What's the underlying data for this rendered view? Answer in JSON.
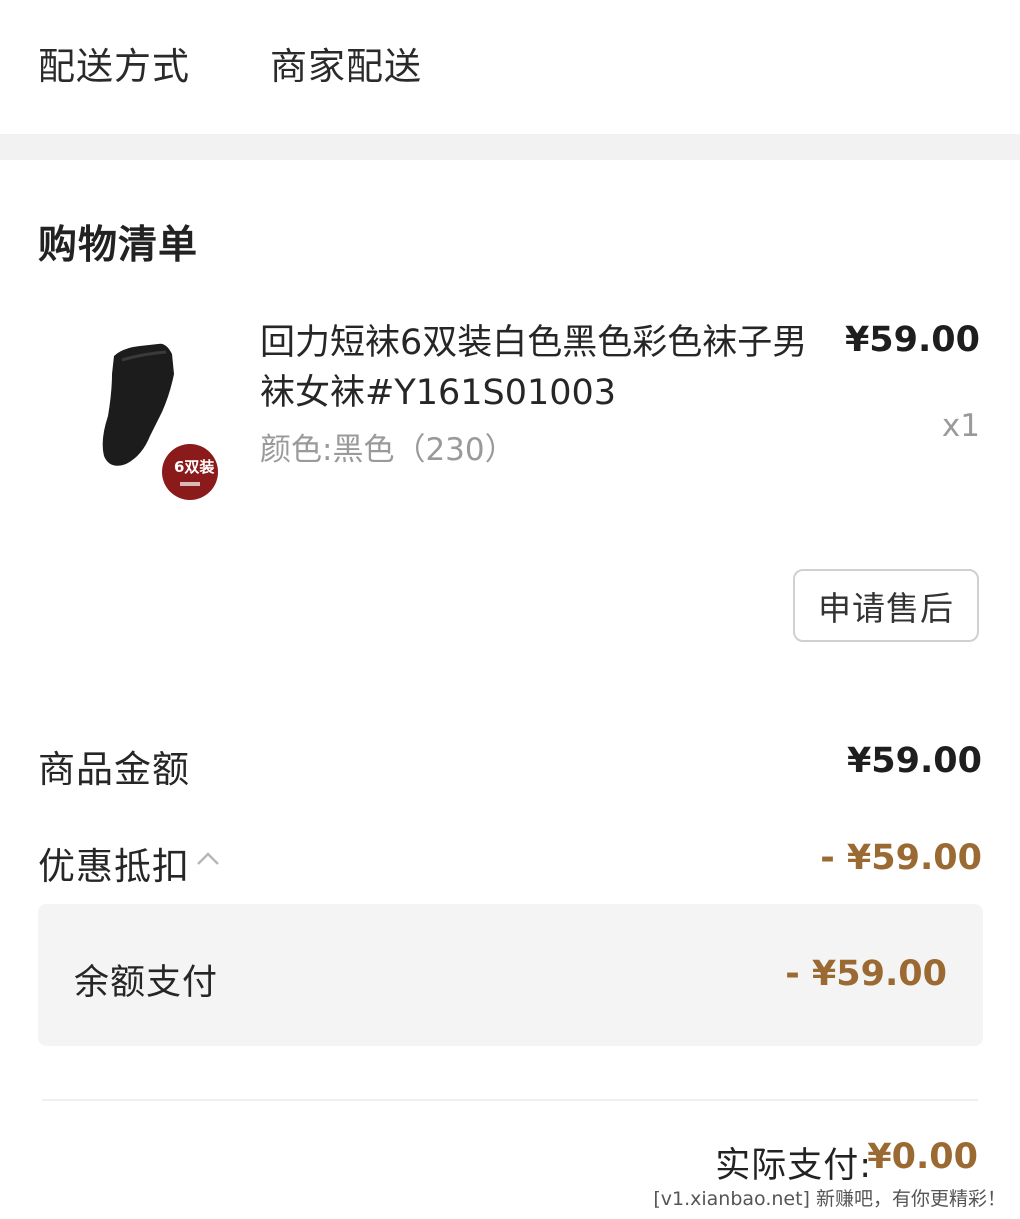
{
  "delivery": {
    "label": "配送方式",
    "value": "商家配送"
  },
  "order": {
    "section_title": "购物清单",
    "product": {
      "name": "回力短袜6双装白色黑色彩色袜子男袜女袜#Y161S01003",
      "spec": "颜色:黑色（230）",
      "price": "¥59.00",
      "quantity": "x1",
      "thumbnail_badge": "6双装",
      "thumbnail_icon": "sock-icon"
    },
    "aftersale_button": "申请售后"
  },
  "summary": {
    "goods_amount_label": "商品金额",
    "goods_amount_value": "¥59.00",
    "discount_label": "优惠抵扣",
    "discount_value": "- ¥59.00",
    "balance_label": "余额支付",
    "balance_value": "- ¥59.00",
    "actual_pay_label": "实际支付:",
    "actual_pay_value": "¥0.00"
  },
  "watermark": "[v1.xianbao.net] 新赚吧，有你更精彩！",
  "colors": {
    "accent": "#9b6a32",
    "divider": "#f2f2f2",
    "badge": "#8b1a1a"
  }
}
